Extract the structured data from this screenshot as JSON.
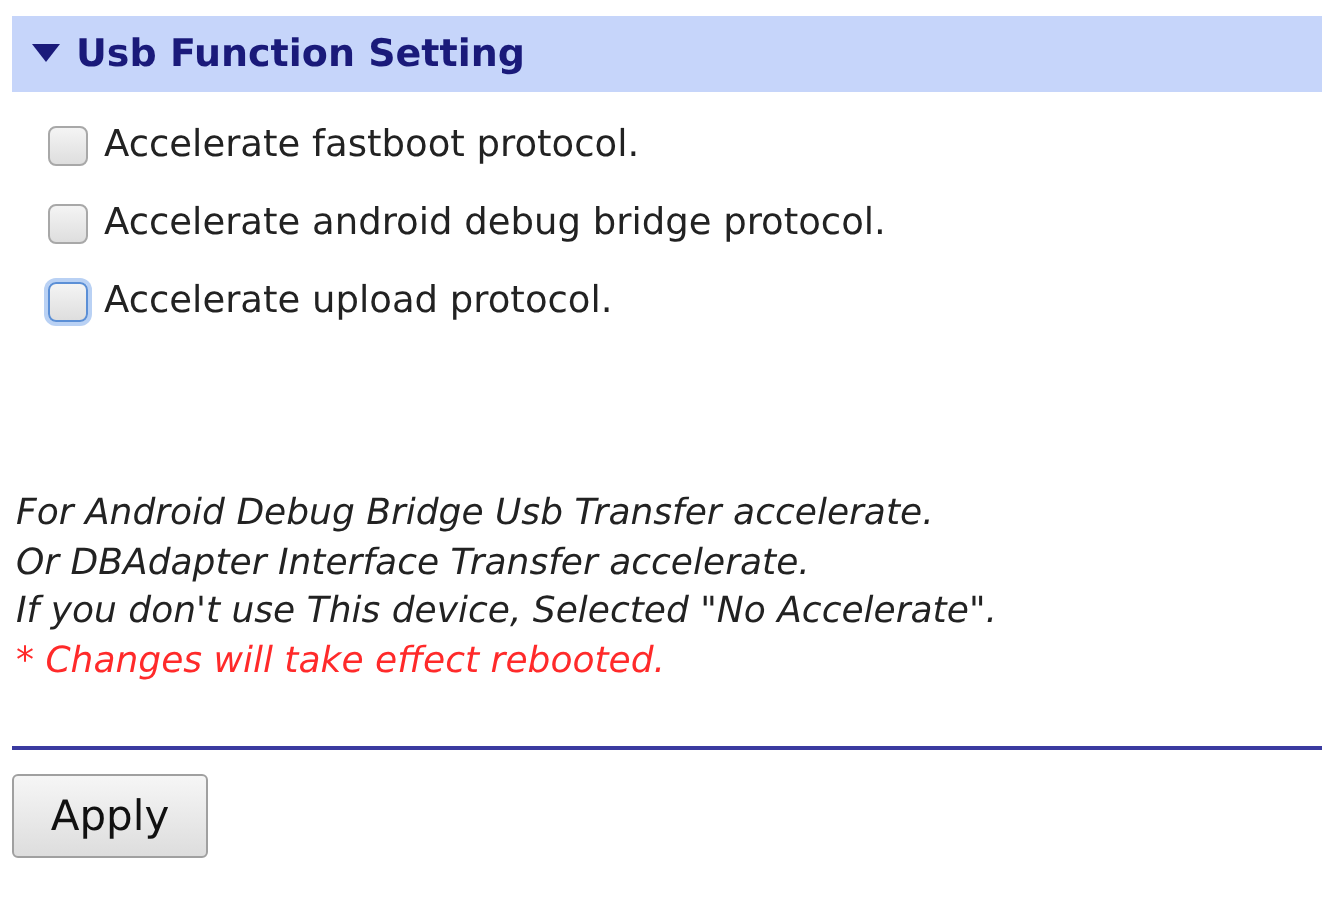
{
  "section": {
    "title": "Usb Function Setting",
    "expanded": true
  },
  "options": [
    {
      "label": "Accelerate fastboot protocol.",
      "checked": false,
      "focused": false
    },
    {
      "label": "Accelerate android debug bridge protocol.",
      "checked": false,
      "focused": false
    },
    {
      "label": "Accelerate upload protocol.",
      "checked": false,
      "focused": true
    }
  ],
  "notes": [
    {
      "text": "For Android Debug Bridge Usb Transfer accelerate.",
      "kind": "info"
    },
    {
      "text": "Or DBAdapter Interface Transfer accelerate.",
      "kind": "info"
    },
    {
      "text": "If you don't use This device, Selected \"No Accelerate\".",
      "kind": "info"
    },
    {
      "text": "* Changes will take effect rebooted.",
      "kind": "warning"
    }
  ],
  "buttons": [
    {
      "label": "Apply"
    }
  ]
}
